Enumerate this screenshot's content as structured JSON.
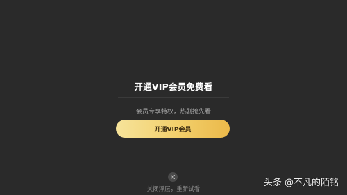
{
  "paywall": {
    "title": "开通VIP会员免费看",
    "subtitle": "会员专享特权，热剧抢先看",
    "cta_label": "开通VIP会员",
    "close_label": "关闭浮层，重新试看",
    "close_icon": "close-icon"
  },
  "watermark": {
    "text": "头条 @不凡的陌铭"
  },
  "colors": {
    "background": "#2a2a2a",
    "button_gradient_start": "#f6e39a",
    "button_gradient_end": "#ebb94a"
  }
}
